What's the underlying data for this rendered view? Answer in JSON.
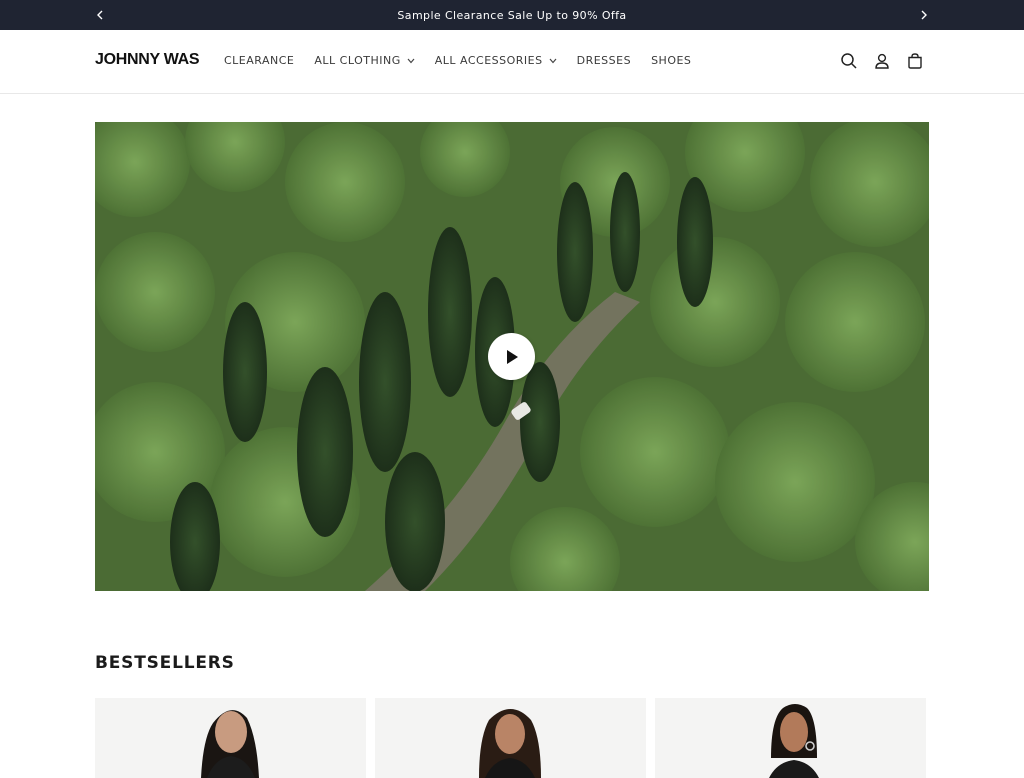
{
  "announcement": {
    "text": "Sample Clearance Sale Up to 90% Offa"
  },
  "header": {
    "logo": "JOHNNY WAS",
    "nav": [
      {
        "label": "CLEARANCE",
        "has_dropdown": false
      },
      {
        "label": "ALL CLOTHING",
        "has_dropdown": true
      },
      {
        "label": "ALL ACCESSORIES",
        "has_dropdown": true
      },
      {
        "label": "DRESSES",
        "has_dropdown": false
      },
      {
        "label": "SHOES",
        "has_dropdown": false
      }
    ],
    "icons": [
      "search-icon",
      "account-icon",
      "cart-icon"
    ]
  },
  "hero": {
    "media": "video",
    "icon": "play-icon"
  },
  "bestsellers": {
    "title": "BESTSELLERS",
    "products": [
      {
        "image": "model-dark-hair-photo"
      },
      {
        "image": "model-dark-hair-photo"
      },
      {
        "image": "model-earrings-photo"
      }
    ]
  },
  "colors": {
    "announcement_bg": "#1f2432",
    "forest_green": "#3f5a2c"
  }
}
